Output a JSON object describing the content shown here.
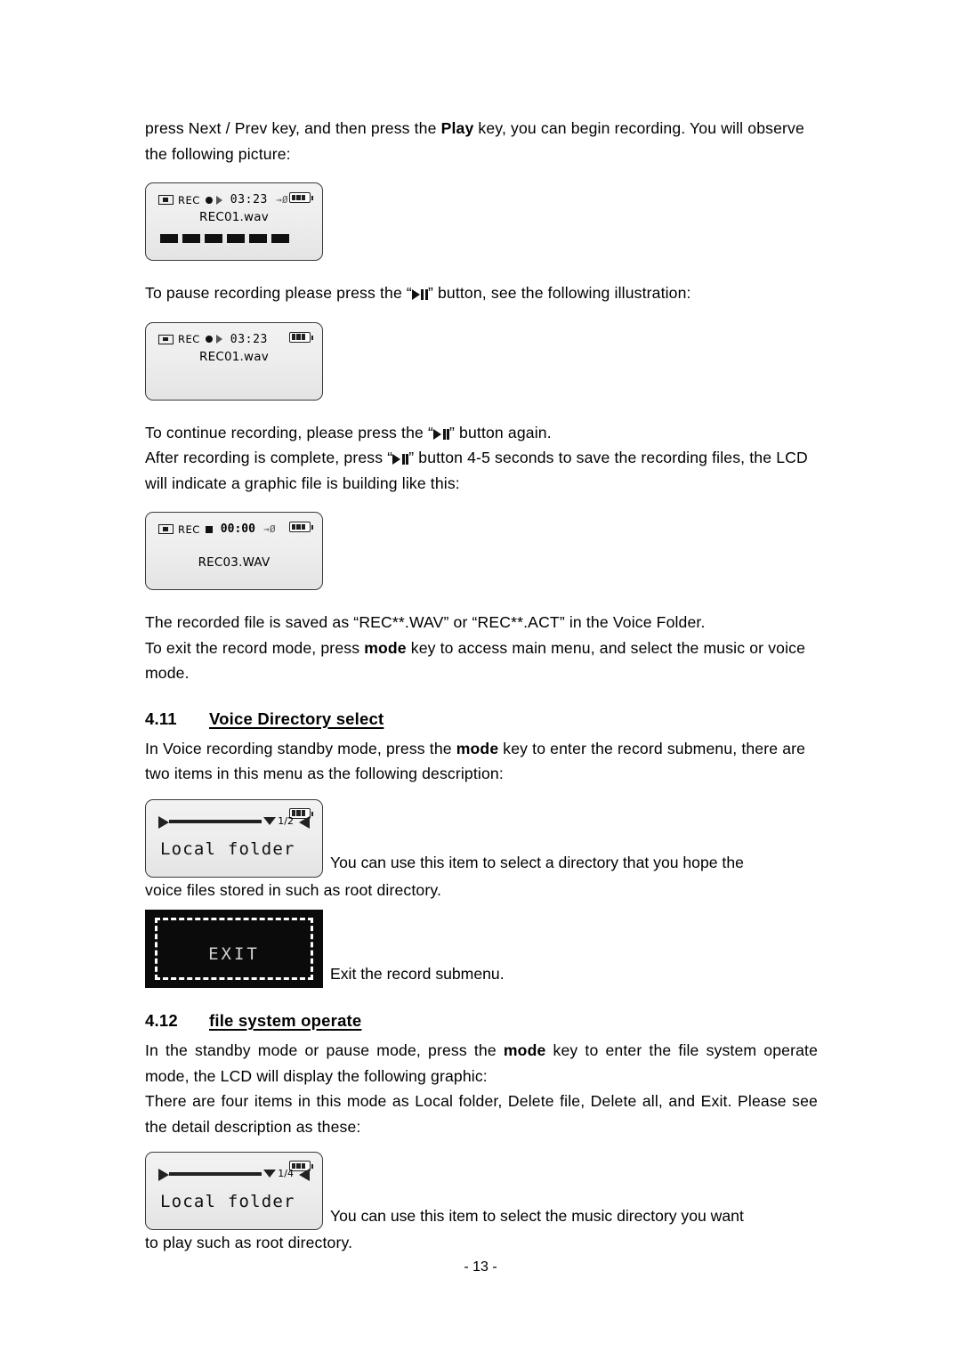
{
  "document": {
    "page_number": "- 13 -",
    "paragraphs": {
      "p1_part1": "press Next / Prev key, and then press the ",
      "p1_bold": "Play",
      "p1_part2": " key, you can begin recording. You will observe the following picture:",
      "p2_part1": "To pause recording please press the “",
      "p2_part2": "” button, see the following illustration:",
      "p3_part1": "To continue recording, please press the “",
      "p3_part2": "” button again.",
      "p4_part1": "After recording is complete, press “",
      "p4_part2": "” button 4-5 seconds to save the recording files, the LCD will indicate a graphic file is building like this:",
      "p5": "The recorded file is saved as “REC**.WAV” or “REC**.ACT” in the Voice Folder.",
      "p6_part1": "To exit the record mode, press ",
      "p6_bold": "mode",
      "p6_part2": " key to access main menu, and select the music or voice mode.",
      "p7_part1": "In Voice recording standby mode, press the ",
      "p7_bold": "mode",
      "p7_part2": " key to enter the record submenu, there are two items in this menu as the following description:",
      "p8_after_lcd": "You can use this item to select a directory that you hope the",
      "p8_cont": "voice files stored in such as root directory.",
      "p9_after_lcd": "Exit the record submenu.",
      "p10_part1": "In the standby mode or pause mode, press the ",
      "p10_bold": "mode",
      "p10_part2": " key to enter the file system operate mode, the LCD will display the following graphic:",
      "p11": "There are four items in this mode as Local folder, Delete file, Delete all, and Exit. Please see the detail description as these:",
      "p12_after_lcd": "You can use this item to select the music directory you want",
      "p12_cont": "to play such as root directory."
    },
    "headings": [
      {
        "number": "4.11",
        "title": "Voice Directory select"
      },
      {
        "number": "4.12",
        "title": "file system operate"
      }
    ],
    "figures": {
      "fig1": {
        "rec_label": "REC",
        "time": "03:23",
        "arrow": "→Ø",
        "filename": "REC01.wav",
        "bars": 6,
        "state": "recording"
      },
      "fig2": {
        "rec_label": "REC",
        "time": "03:23",
        "filename": "REC01.wav",
        "bars": 0,
        "state": "paused"
      },
      "fig3": {
        "rec_label": "REC",
        "time": "00:00",
        "arrow": "→Ø",
        "filename": "REC03.WAV",
        "bars": 0,
        "state": "stopped"
      },
      "fig4": {
        "index": "1/2",
        "label": "Local folder"
      },
      "fig5": {
        "label": "EXIT",
        "inverted": true
      },
      "fig6": {
        "index": "1/4",
        "label": "Local folder"
      }
    }
  }
}
